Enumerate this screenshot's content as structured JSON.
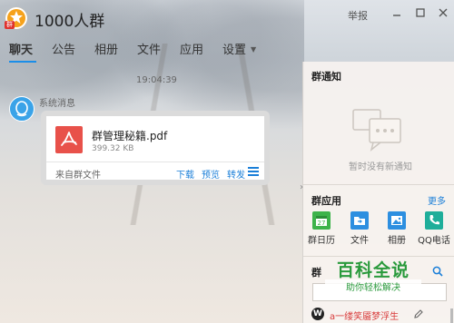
{
  "window": {
    "title": "1000人群",
    "logo_badge": "群",
    "report_label": "举报",
    "controls": [
      "minimize",
      "maximize",
      "close"
    ]
  },
  "tabs": [
    {
      "label": "聊天",
      "active": true
    },
    {
      "label": "公告",
      "active": false
    },
    {
      "label": "相册",
      "active": false
    },
    {
      "label": "文件",
      "active": false
    },
    {
      "label": "应用",
      "active": false
    },
    {
      "label": "设置",
      "active": false,
      "has_dropdown": true
    }
  ],
  "chat": {
    "timestamp": "19:04:39",
    "sender": "系统消息",
    "file_card": {
      "file_name": "群管理秘籍.pdf",
      "file_size": "399.32 KB",
      "source": "来自群文件",
      "actions": {
        "download": "下载",
        "preview": "预览",
        "forward": "转发"
      }
    }
  },
  "sidebar": {
    "notice_title": "群通知",
    "notice_empty": "暂时没有新通知",
    "apps_title": "群应用",
    "apps_more": "更多",
    "apps": [
      {
        "label": "群日历",
        "icon": "calendar-icon",
        "color": "#3db34a"
      },
      {
        "label": "文件",
        "icon": "folder-icon",
        "color": "#2d8fe0"
      },
      {
        "label": "相册",
        "icon": "photo-icon",
        "color": "#2d8fe0"
      },
      {
        "label": "QQ电话",
        "icon": "phone-icon",
        "color": "#1fae9a"
      }
    ],
    "members_title": "群",
    "member": {
      "avatar_letter": "W",
      "name": "a一缕笑靥梦浮生"
    }
  },
  "watermark": {
    "title": "百科全说",
    "subtitle": "助你轻松解决"
  },
  "colors": {
    "accent": "#1b8ee8",
    "link": "#1b7fd8",
    "pdf": "#e8514a",
    "watermark": "#2a9a3c"
  }
}
